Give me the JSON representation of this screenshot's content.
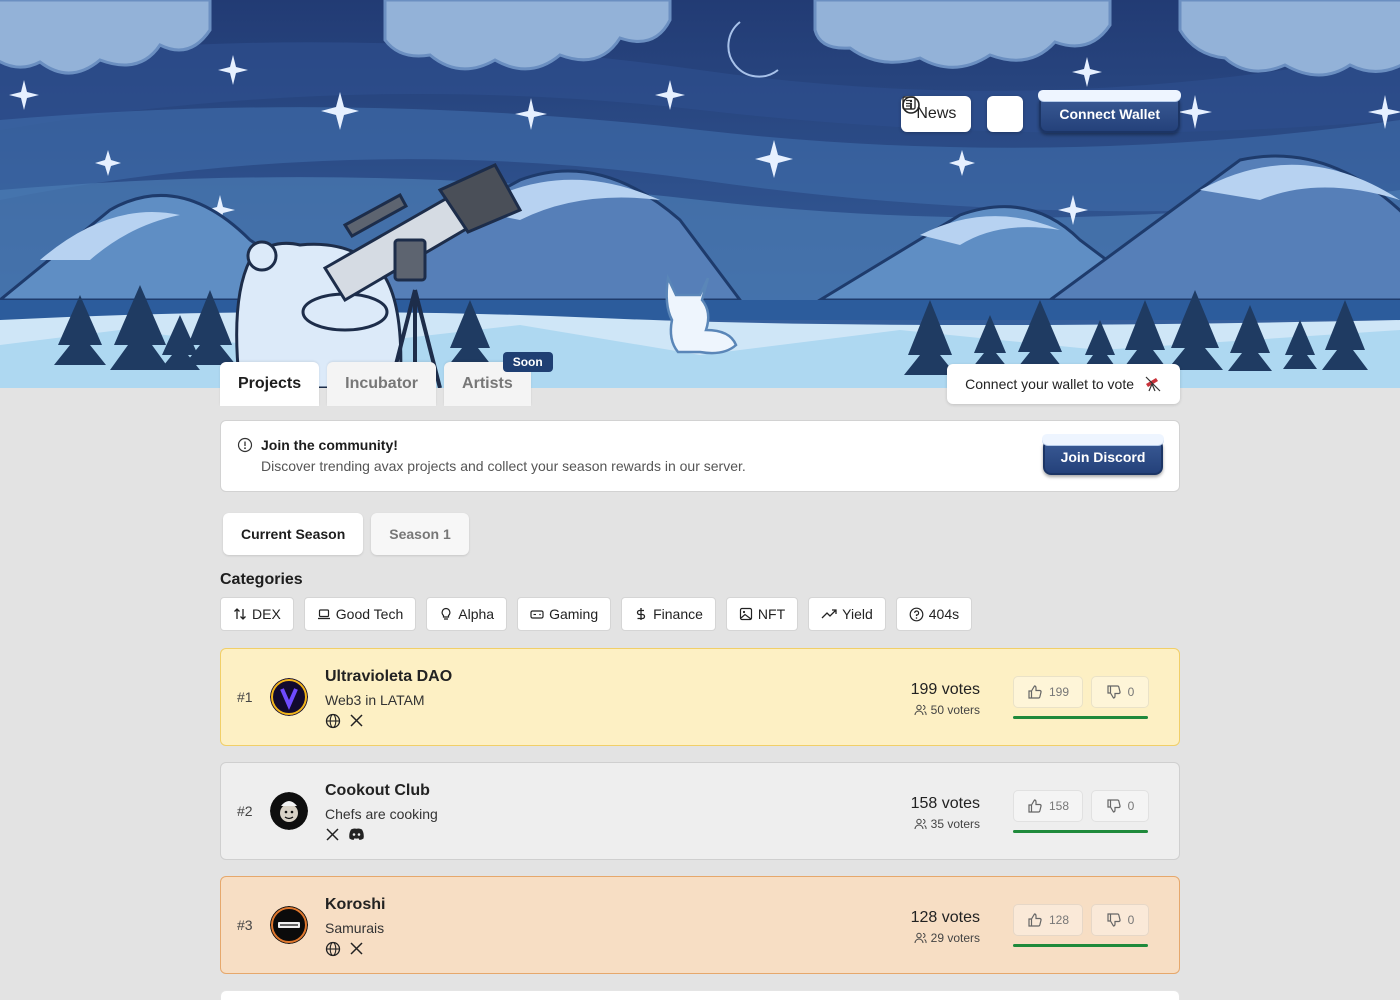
{
  "header": {
    "news_label": "News",
    "info_icon": "info-icon",
    "connect_wallet_label": "Connect Wallet"
  },
  "tabs": [
    {
      "label": "Projects",
      "active": true
    },
    {
      "label": "Incubator",
      "active": false
    },
    {
      "label": "Artists",
      "active": false,
      "badge": "Soon"
    }
  ],
  "vote_hint": {
    "label": "Connect your wallet to vote",
    "icon": "telescope-icon"
  },
  "community": {
    "title": "Join the community!",
    "text": "Discover trending avax projects and collect your season rewards in our server.",
    "button": "Join Discord"
  },
  "seasons": [
    {
      "label": "Current Season",
      "active": true
    },
    {
      "label": "Season 1",
      "active": false
    }
  ],
  "categories_title": "Categories",
  "categories": [
    {
      "label": "DEX",
      "icon": "arrows-up-down-icon"
    },
    {
      "label": "Good Tech",
      "icon": "laptop-icon"
    },
    {
      "label": "Alpha",
      "icon": "lightbulb-icon"
    },
    {
      "label": "Gaming",
      "icon": "gamepad-icon"
    },
    {
      "label": "Finance",
      "icon": "dollar-icon"
    },
    {
      "label": "NFT",
      "icon": "image-icon"
    },
    {
      "label": "Yield",
      "icon": "trending-up-icon"
    },
    {
      "label": "404s",
      "icon": "question-circle-icon"
    }
  ],
  "projects": [
    {
      "rank": "#1",
      "name": "Ultravioleta DAO",
      "desc": "Web3 in LATAM",
      "votes": "199 votes",
      "voters": "50 voters",
      "up": "199",
      "down": "0",
      "links": [
        "globe-icon",
        "x-icon"
      ],
      "tier": "gold",
      "upvote_share": 1
    },
    {
      "rank": "#2",
      "name": "Cookout Club",
      "desc": "Chefs are cooking",
      "votes": "158 votes",
      "voters": "35 voters",
      "up": "158",
      "down": "0",
      "links": [
        "x-icon",
        "discord-icon"
      ],
      "tier": "silver",
      "upvote_share": 1
    },
    {
      "rank": "#3",
      "name": "Koroshi",
      "desc": "Samurais",
      "votes": "128 votes",
      "voters": "29 voters",
      "up": "128",
      "down": "0",
      "links": [
        "globe-icon",
        "x-icon"
      ],
      "tier": "bronze",
      "upvote_share": 1
    }
  ],
  "colors": {
    "brand_button": "#2b4a85",
    "vote_bar": "#1f8a3b",
    "gold_card": "#fdf0c4",
    "bronze_card": "#f7dec4"
  }
}
